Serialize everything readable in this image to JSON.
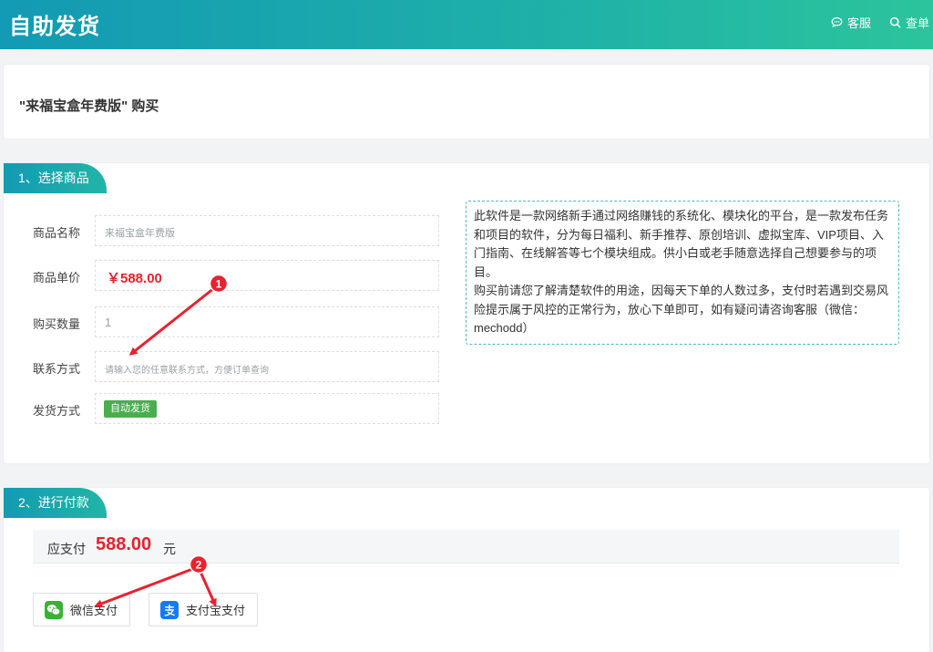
{
  "header": {
    "title": "自助发货",
    "nav": [
      {
        "label": "客服",
        "icon": "chat-icon"
      },
      {
        "label": "查单",
        "icon": "search-icon"
      }
    ]
  },
  "product_card": {
    "title": "\"来福宝盒年费版\" 购买"
  },
  "select_section": {
    "tab": "1、选择商品",
    "fields": {
      "name_label": "商品名称",
      "name_value": "来福宝盒年费版",
      "price_label": "商品单价",
      "price_value": "￥588.00",
      "qty_label": "购买数量",
      "qty_value": "1",
      "contact_label": "联系方式",
      "contact_placeholder": "请输入您的任意联系方式，方便订单查询",
      "delivery_label": "发货方式",
      "delivery_badge": "自动发货"
    },
    "description": [
      "此软件是一款网络新手通过网络赚钱的系统化、模块化的平台，是一款发布任务和项目的软件，分为每日福利、新手推荐、原创培训、虚拟宝库、VIP项目、入门指南、在线解答等七个模块组成。供小白或老手随意选择自己想要参与的项目。",
      "购买前请您了解清楚软件的用途，因每天下单的人数过多，支付时若遇到交易风险提示属于风控的正常行为，放心下单即可，如有疑问请咨询客服（微信：mechodd）"
    ]
  },
  "pay_section": {
    "tab": "2、进行付款",
    "due_label": "应支付",
    "amount": "588.00",
    "unit": "元",
    "methods": [
      {
        "label": "微信支付",
        "icon": "wechat-icon",
        "color": "#3cb034"
      },
      {
        "label": "支付宝支付",
        "icon": "alipay-icon",
        "color": "#1678ff"
      }
    ]
  },
  "annotations": {
    "marker_1": "1",
    "marker_2": "2",
    "color": "#e8222e"
  },
  "colors": {
    "header_gradient_start": "#139ab4",
    "header_gradient_end": "#2cc49c",
    "price_red": "#e8222e",
    "badge_green": "#4aae4f"
  }
}
